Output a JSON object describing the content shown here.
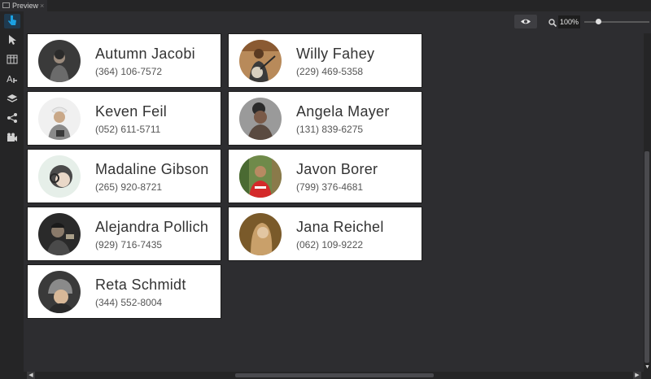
{
  "tab": {
    "label": "Preview",
    "close": "×",
    "icon": "preview-window-icon"
  },
  "toolbar": {
    "eye_icon": "eye-icon",
    "zoom_icon": "magnifier-icon",
    "zoom": "100%",
    "zoom_level": 1.0
  },
  "tools": [
    {
      "icon": "touch-pointer-icon"
    },
    {
      "icon": "arrow-pointer-icon"
    },
    {
      "icon": "table-icon"
    },
    {
      "icon": "text-style-icon"
    },
    {
      "icon": "layers-icon"
    },
    {
      "icon": "share-flow-icon"
    },
    {
      "icon": "video-camera-icon"
    }
  ],
  "contacts": [
    {
      "name": "Autumn Jacobi",
      "phone": "(364) 106-7572"
    },
    {
      "name": "Willy Fahey",
      "phone": "(229) 469-5358"
    },
    {
      "name": "Keven Feil",
      "phone": "(052) 611-5711"
    },
    {
      "name": "Angela Mayer",
      "phone": "(131) 839-6275"
    },
    {
      "name": "Madaline Gibson",
      "phone": "(265) 920-8721"
    },
    {
      "name": "Javon Borer",
      "phone": "(799) 376-4681"
    },
    {
      "name": "Alejandra Pollich",
      "phone": "(929) 716-7435"
    },
    {
      "name": "Jana Reichel",
      "phone": "(062) 109-9222"
    },
    {
      "name": "Reta Schmidt",
      "phone": "(344) 552-8004"
    }
  ]
}
